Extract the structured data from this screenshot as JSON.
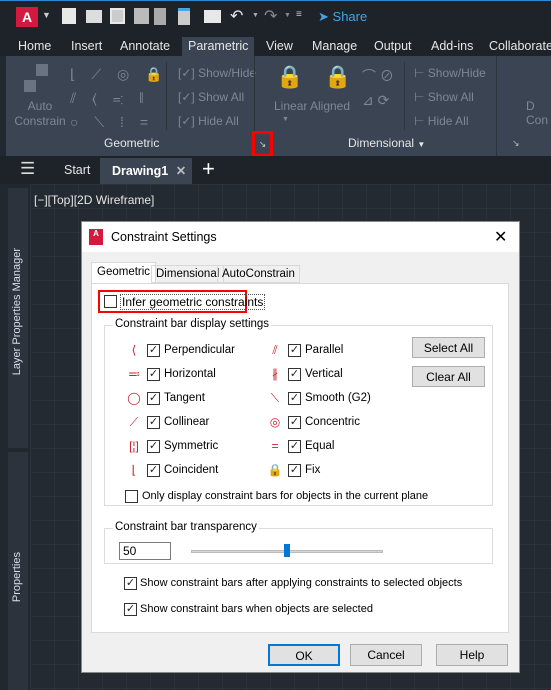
{
  "app": {
    "share_label": "Share"
  },
  "ribbon_tabs": [
    "Home",
    "Insert",
    "Annotate",
    "Parametric",
    "View",
    "Manage",
    "Output",
    "Add-ins",
    "Collaborate"
  ],
  "ribbon": {
    "auto_constrain": "Auto Constrain",
    "geo_show_hide": "Show/Hide",
    "geo_show_all": "Show All",
    "geo_hide_all": "Hide All",
    "linear": "Linear",
    "aligned": "Aligned",
    "dim_show_hide": "Show/Hide",
    "dim_show_all": "Show All",
    "dim_hide_all": "Hide All",
    "panel_geometric": "Geometric",
    "panel_dimensional": "Dimensional"
  },
  "doc_tabs": {
    "start": "Start",
    "drawing": "Drawing1"
  },
  "viewport_label": "[−][Top][2D Wireframe]",
  "palettes": {
    "layer": "Layer Properties Manager",
    "properties": "Properties"
  },
  "dialog": {
    "title": "Constraint Settings",
    "tabs": [
      "Geometric",
      "Dimensional",
      "AutoConstrain"
    ],
    "infer_label": "Infer geometric constraints",
    "infer_checked": false,
    "group_label": "Constraint bar display settings",
    "constraints": [
      {
        "label": "Perpendicular",
        "checked": true,
        "icon": "perpendicular-icon"
      },
      {
        "label": "Parallel",
        "checked": true,
        "icon": "parallel-icon"
      },
      {
        "label": "Horizontal",
        "checked": true,
        "icon": "horizontal-icon"
      },
      {
        "label": "Vertical",
        "checked": true,
        "icon": "vertical-icon"
      },
      {
        "label": "Tangent",
        "checked": true,
        "icon": "tangent-icon"
      },
      {
        "label": "Smooth (G2)",
        "checked": true,
        "icon": "smooth-icon"
      },
      {
        "label": "Collinear",
        "checked": true,
        "icon": "collinear-icon"
      },
      {
        "label": "Concentric",
        "checked": true,
        "icon": "concentric-icon"
      },
      {
        "label": "Symmetric",
        "checked": true,
        "icon": "symmetric-icon"
      },
      {
        "label": "Equal",
        "checked": true,
        "icon": "equal-icon"
      },
      {
        "label": "Coincident",
        "checked": true,
        "icon": "coincident-icon"
      },
      {
        "label": "Fix",
        "checked": true,
        "icon": "fix-icon"
      }
    ],
    "select_all": "Select All",
    "clear_all": "Clear All",
    "only_current_plane": "Only display constraint bars for objects in the current plane",
    "only_current_plane_checked": false,
    "transparency_label": "Constraint bar transparency",
    "transparency_value": "50",
    "transparency_percent": 50,
    "show_after_applying": "Show constraint bars after applying constraints to selected objects",
    "show_after_applying_checked": true,
    "show_when_selected": "Show constraint bars when objects are selected",
    "show_when_selected_checked": true,
    "ok": "OK",
    "cancel": "Cancel",
    "help": "Help"
  },
  "colors": {
    "accent": "#c8232c",
    "highlight": "#ff0000",
    "share": "#4aa3df"
  }
}
